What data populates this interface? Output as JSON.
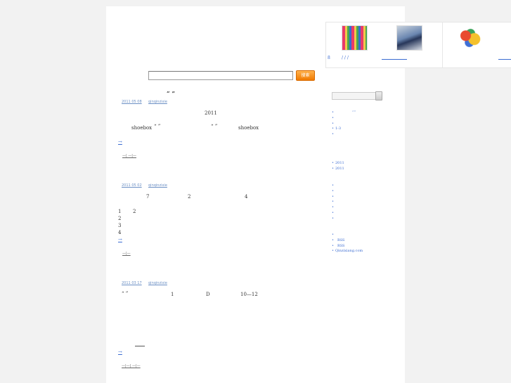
{
  "ad_strip": {
    "label_left": "8",
    "label_mid": "/ / /",
    "items": [
      "colorful-shoes-thumbnail",
      "sneaker-thumbnail",
      "toys-thumbnail"
    ]
  },
  "search": {
    "value": "",
    "button_label": "搜索"
  },
  "quote": "“ ”",
  "posts": [
    {
      "meta_date": "2011 05 08",
      "meta_author": "qinqinzixie",
      "line1_year": "2011",
      "line2_a": "shoebox",
      "line2_b": "“ ”",
      "line2_c": "“ ”",
      "line2_d": "shoebox",
      "more": "→",
      "footer": "—| —|—"
    },
    {
      "meta_date": "2011 05 02",
      "meta_author": "qinqinzixie",
      "line1_a": "7",
      "line1_b": "2",
      "line1_c": "4",
      "list": [
        "1",
        "2",
        "3",
        "4"
      ],
      "list_extra": "2",
      "more": "→",
      "footer": "—|—"
    },
    {
      "meta_date": "2011 03 17",
      "meta_author": "qinqinzixie",
      "line1_a": "“ ”",
      "line1_b": "1",
      "line1_c": "D",
      "line1_d": "10—12",
      "more": "→",
      "footer": "—|—| —|—"
    }
  ],
  "sidebar": {
    "search_value": "",
    "group1": [
      "“”",
      "",
      "",
      "1-3",
      ""
    ],
    "group2": [
      "2011",
      "2011"
    ],
    "group3": [
      "",
      "",
      "",
      "",
      "",
      "",
      ""
    ],
    "group4": [
      "",
      "RSS",
      "RSS",
      "Qinzixiang.com"
    ]
  }
}
